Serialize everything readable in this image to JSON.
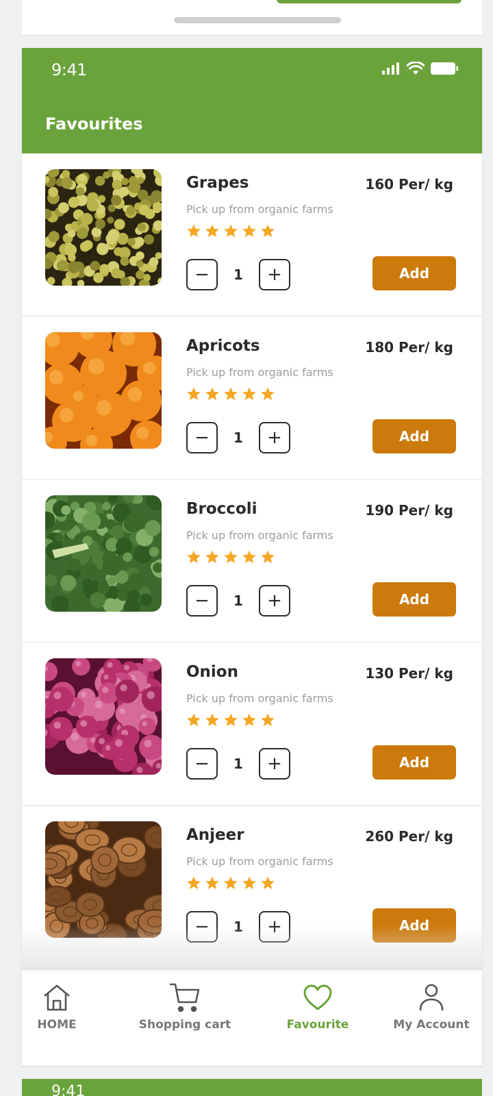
{
  "status_bar": {
    "time": "9:41",
    "next_time": "9:41"
  },
  "header": {
    "title": "Favourites"
  },
  "colors": {
    "brand_green": "#6aa33b",
    "add_orange": "#cc7a0c",
    "star": "#f5a623"
  },
  "items": [
    {
      "name": "Grapes",
      "price": "160 Per/ kg",
      "description": "Pick up from organic farms",
      "rating": 5,
      "quantity": "1",
      "minus": "−",
      "plus": "+",
      "add_label": "Add",
      "image": "grapes"
    },
    {
      "name": "Apricots",
      "price": "180 Per/ kg",
      "description": "Pick up from organic farms",
      "rating": 5,
      "quantity": "1",
      "minus": "−",
      "plus": "+",
      "add_label": "Add",
      "image": "apricots"
    },
    {
      "name": "Broccoli",
      "price": "190 Per/ kg",
      "description": "Pick up from organic farms",
      "rating": 5,
      "quantity": "1",
      "minus": "−",
      "plus": "+",
      "add_label": "Add",
      "image": "broccoli"
    },
    {
      "name": "Onion",
      "price": "130 Per/ kg",
      "description": "Pick up from organic farms",
      "rating": 5,
      "quantity": "1",
      "minus": "−",
      "plus": "+",
      "add_label": "Add",
      "image": "onion"
    },
    {
      "name": "Anjeer",
      "price": "260 Per/ kg",
      "description": "Pick up from organic farms",
      "rating": 5,
      "quantity": "1",
      "minus": "−",
      "plus": "+",
      "add_label": "Add",
      "image": "anjeer"
    }
  ],
  "nav": {
    "home": {
      "label": "HOME",
      "icon": "home-icon"
    },
    "cart": {
      "label": "Shopping cart",
      "icon": "cart-icon"
    },
    "favourite": {
      "label": "Favourite",
      "icon": "heart-icon",
      "active": true
    },
    "account": {
      "label": "My Account",
      "icon": "user-icon"
    }
  }
}
